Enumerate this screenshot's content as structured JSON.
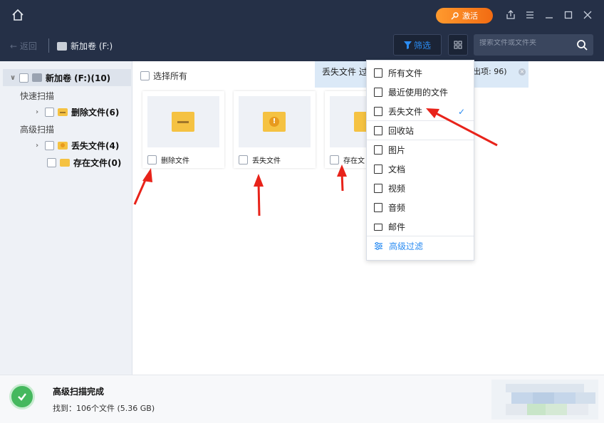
{
  "titlebar": {
    "activate_label": "激活",
    "window_controls": [
      "share-icon",
      "menu-icon",
      "minimize-icon",
      "maximize-icon",
      "close-icon"
    ]
  },
  "nav": {
    "back_label": "返回",
    "breadcrumb": "新加卷 (F:)",
    "filter_label": "筛选",
    "search_placeholder": "搜索文件或文件夹"
  },
  "sidebar": {
    "root_label": "新加卷 (F:)(10)",
    "quick_scan_label": "快速扫描",
    "deleted_label": "删除文件(6)",
    "advanced_scan_label": "高级扫描",
    "lost_label": "丢失文件(4)",
    "existing_label": "存在文件(0)"
  },
  "main": {
    "select_all_label": "选择所有",
    "banner_left": "丢失文件 过",
    "banner_right": "出项: 96)",
    "cards": [
      {
        "label": "删除文件"
      },
      {
        "label": "丢失文件"
      },
      {
        "label": "存在文"
      }
    ]
  },
  "filter_menu": {
    "items": [
      {
        "label": "所有文件",
        "icon": "file-icon"
      },
      {
        "label": "最近使用的文件",
        "icon": "recent-file-icon"
      },
      {
        "label": "丢失文件",
        "icon": "lost-file-icon",
        "checked": true
      },
      {
        "label": "回收站",
        "icon": "recycle-bin-icon"
      },
      {
        "label": "图片",
        "icon": "image-icon"
      },
      {
        "label": "文档",
        "icon": "document-icon"
      },
      {
        "label": "视频",
        "icon": "video-icon"
      },
      {
        "label": "音频",
        "icon": "audio-icon"
      },
      {
        "label": "邮件",
        "icon": "mail-icon"
      }
    ],
    "advanced_label": "高级过滤",
    "check_mark": "✓"
  },
  "footer": {
    "status_title": "高级扫描完成",
    "status_detail": "找到：106个文件 (5.36 GB)"
  },
  "colors": {
    "titlebar_bg": "#253047",
    "accent_blue": "#2b8cf2",
    "activate_orange": "#f26b12",
    "success_green": "#45b85e",
    "annotation_red": "#e8231a"
  }
}
